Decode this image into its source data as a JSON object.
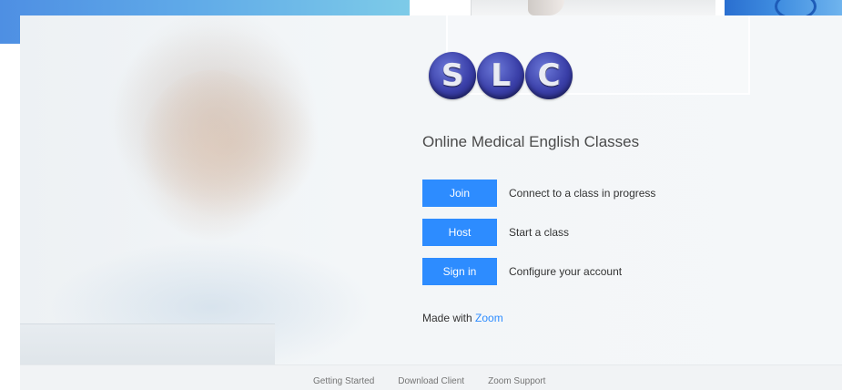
{
  "logo": {
    "letters": [
      "S",
      "L",
      "C"
    ]
  },
  "product": {
    "title": "Online Medical English Classes"
  },
  "actions": [
    {
      "button_label": "Join",
      "description": "Connect to a class in progress"
    },
    {
      "button_label": "Host",
      "description": "Start a class"
    },
    {
      "button_label": "Sign in",
      "description": "Configure your account"
    }
  ],
  "made_with": {
    "prefix": "Made with",
    "link_label": "Zoom"
  },
  "footer": {
    "links": [
      "Getting Started",
      "Download Client",
      "Zoom Support"
    ]
  },
  "colors": {
    "accent": "#2d8cff",
    "logo_blue": "#3a3fa8",
    "text": "#333333"
  }
}
